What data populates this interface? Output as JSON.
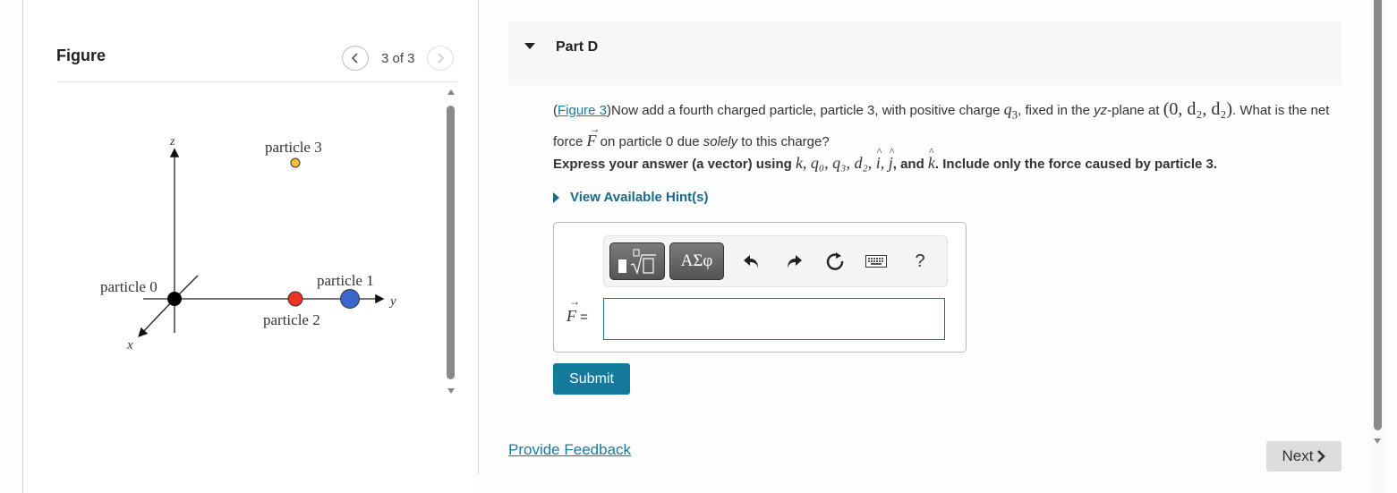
{
  "figure_panel": {
    "title": "Figure",
    "nav": {
      "current": 3,
      "total": 3,
      "counter_text": "3 of 3",
      "prev_icon": "chevron-left-icon",
      "next_icon": "chevron-right-icon"
    },
    "diagram": {
      "axis_labels": {
        "z": "z",
        "y": "y",
        "x": "x"
      },
      "particles": [
        {
          "label": "particle 0",
          "color": "#000000"
        },
        {
          "label": "particle 1",
          "color": "#3a67cc"
        },
        {
          "label": "particle 2",
          "color": "#ee3322"
        },
        {
          "label": "particle 3",
          "color": "#f5c033"
        }
      ]
    }
  },
  "part": {
    "title": "Part D",
    "question": {
      "figure_link": "Figure 3",
      "text_1": "Now add a fourth charged particle, particle 3, with positive charge ",
      "charge_symbol": "q",
      "charge_sub": "3",
      "text_2": ", fixed in the ",
      "plane": "yz",
      "text_3": "-plane at ",
      "position": "(0, d₂, d₂)",
      "text_4": ". What is the net force ",
      "force_symbol": "F",
      "text_5": " on particle 0 due ",
      "emphasis": "solely",
      "text_6": " to this charge?"
    },
    "instruction": {
      "prefix": "Express your answer (a vector) using ",
      "variables": "k, q₀, q₃, d₂, ",
      "i_hat": "i",
      "j_hat": "j",
      "and": ", and ",
      "k_hat": "k",
      "suffix": ". Include only the force caused by particle 3."
    },
    "hints_label": "View Available Hint(s)",
    "answer": {
      "label_symbol": "F",
      "label_eq": " =",
      "value": "",
      "toolbar": {
        "templates_icon": "templates-sqrt-icon",
        "symbols_label": "ΑΣφ",
        "undo_icon": "undo-icon",
        "redo_icon": "redo-icon",
        "reset_icon": "reset-icon",
        "keyboard_icon": "keyboard-icon",
        "help_label": "?"
      }
    },
    "submit_label": "Submit"
  },
  "footer": {
    "feedback_label": "Provide Feedback",
    "next_label": "Next"
  },
  "colors": {
    "accent": "#137a9c",
    "link": "#1a7aa0",
    "hint": "#1a6a8e"
  }
}
